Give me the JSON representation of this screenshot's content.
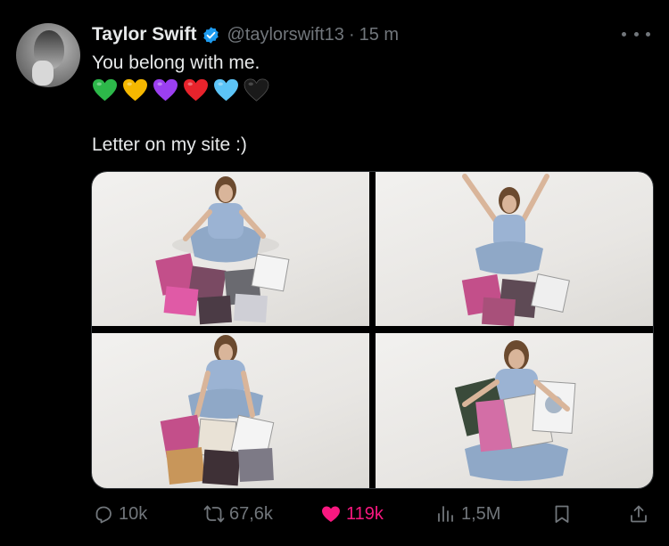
{
  "author": {
    "name": "Taylor Swift",
    "handle": "@taylorswift13",
    "separator": "·",
    "time": "15 m",
    "verified_color": "#1d9bf0"
  },
  "tweet": {
    "text": "You belong with me.",
    "hearts": [
      {
        "name": "green-heart-icon",
        "color": "#2db84a"
      },
      {
        "name": "yellow-heart-icon",
        "color": "#f5b800"
      },
      {
        "name": "purple-heart-icon",
        "color": "#9b3ff0"
      },
      {
        "name": "red-heart-icon",
        "color": "#e8232c"
      },
      {
        "name": "blue-heart-icon",
        "color": "#5cc4f7"
      },
      {
        "name": "black-heart-icon",
        "color": "#1a1a1a"
      }
    ],
    "second_line": "Letter on my site :)"
  },
  "actions": {
    "replies": "10k",
    "reposts": "67,6k",
    "likes": "119k",
    "views": "1,5M"
  },
  "colors": {
    "background": "#000000",
    "text": "#e7e9ea",
    "secondary": "#71767b",
    "like": "#f91880"
  }
}
